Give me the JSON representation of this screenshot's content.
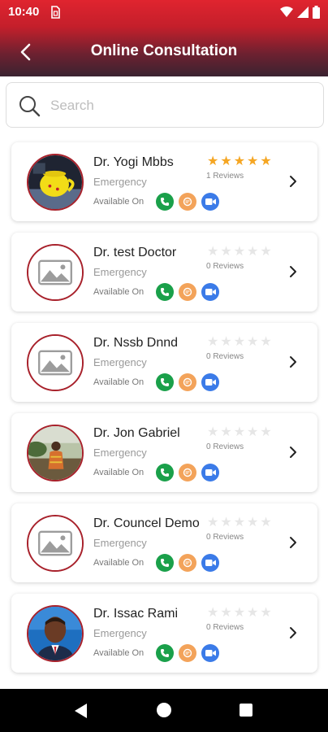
{
  "status_bar": {
    "time": "10:40",
    "icons": [
      "sim-card-icon",
      "wifi-icon",
      "signal-icon",
      "battery-icon"
    ]
  },
  "header": {
    "title": "Online Consultation",
    "back_icon": "chevron-left-icon",
    "gradient_colors": [
      "#e0242f",
      "#3a2230"
    ]
  },
  "search": {
    "placeholder": "Search",
    "value": ""
  },
  "doctors": [
    {
      "name": "Dr. Yogi Mbbs",
      "speciality": "Emergency",
      "available_label": "Available On",
      "rating": 5,
      "reviews": "1 Reviews",
      "avatar": "photo-yellow-cup"
    },
    {
      "name": "Dr. test Doctor",
      "speciality": "Emergency",
      "available_label": "Available On",
      "rating": 0,
      "reviews": "0 Reviews",
      "avatar": "placeholder-image"
    },
    {
      "name": "Dr. Nssb Dnnd",
      "speciality": "Emergency",
      "available_label": "Available On",
      "rating": 0,
      "reviews": "0 Reviews",
      "avatar": "placeholder-image"
    },
    {
      "name": "Dr. Jon Gabriel",
      "speciality": "Emergency",
      "available_label": "Available On",
      "rating": 0,
      "reviews": "0 Reviews",
      "avatar": "photo-person-outdoor"
    },
    {
      "name": "Dr. Councel Demo",
      "speciality": "Emergency",
      "available_label": "Available On",
      "rating": 0,
      "reviews": "0 Reviews",
      "avatar": "placeholder-image"
    },
    {
      "name": "Dr. Issac Rami",
      "speciality": "Emergency",
      "available_label": "Available On",
      "rating": 0,
      "reviews": "0 Reviews",
      "avatar": "photo-man-suit"
    }
  ],
  "channel_icons": [
    "phone-icon",
    "chat-icon",
    "video-icon"
  ],
  "colors": {
    "star_filled": "#f5a623",
    "star_empty": "#e6e6e6",
    "phone": "#1aa04a",
    "chat": "#f3a35a",
    "video": "#3b7be8",
    "avatar_border": "#a8212b"
  },
  "nav_bar": {
    "icons": [
      "nav-back-icon",
      "nav-home-icon",
      "nav-recents-icon"
    ]
  }
}
